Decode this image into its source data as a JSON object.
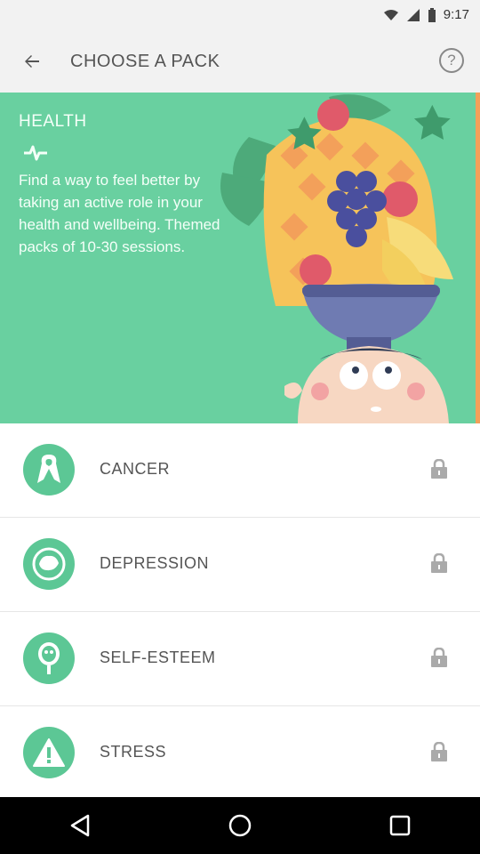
{
  "status_bar": {
    "time": "9:17"
  },
  "app_bar": {
    "back_icon": "arrow-left-icon",
    "title": "CHOOSE A PACK",
    "help_label": "?"
  },
  "hero": {
    "title": "HEALTH",
    "description": "Find a way to feel better by taking an active role in your health and wellbeing. Themed packs of 10-30 sessions."
  },
  "packs": [
    {
      "label": "CANCER",
      "icon": "ribbon-icon",
      "locked": true
    },
    {
      "label": "DEPRESSION",
      "icon": "cloud-face-icon",
      "locked": true
    },
    {
      "label": "SELF-ESTEEM",
      "icon": "mirror-icon",
      "locked": true
    },
    {
      "label": "STRESS",
      "icon": "warning-icon",
      "locked": true
    }
  ],
  "colors": {
    "hero": "#69d0a0",
    "icon_bg": "#5cc795",
    "accent": "#f3a05a"
  }
}
